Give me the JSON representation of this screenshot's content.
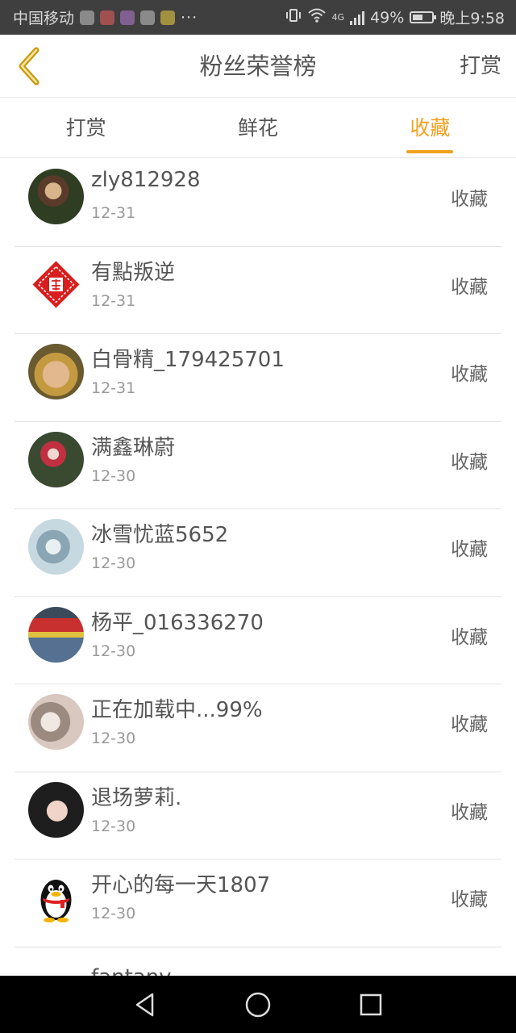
{
  "status_bar": {
    "carrier": "中国移动",
    "more": "···",
    "network_type": "4G",
    "battery": "49%",
    "time": "晚上9:58"
  },
  "header": {
    "title": "粉丝荣誉榜",
    "action": "打赏",
    "back_icon": "chevron-left-icon",
    "accent_color": "#f2a020"
  },
  "tabs": [
    {
      "label": "打赏",
      "active": false
    },
    {
      "label": "鲜花",
      "active": false
    },
    {
      "label": "收藏",
      "active": true
    }
  ],
  "fans": [
    {
      "name": "zly812928",
      "date": "12-31",
      "action": "收藏"
    },
    {
      "name": "有點叛逆",
      "date": "12-31",
      "action": "收藏"
    },
    {
      "name": "白骨精_179425701",
      "date": "12-31",
      "action": "收藏"
    },
    {
      "name": "满鑫琳蔚",
      "date": "12-30",
      "action": "收藏"
    },
    {
      "name": "冰雪忧蓝5652",
      "date": "12-30",
      "action": "收藏"
    },
    {
      "name": "杨平_016336270",
      "date": "12-30",
      "action": "收藏"
    },
    {
      "name": "正在加载中...99%",
      "date": "12-30",
      "action": "收藏"
    },
    {
      "name": "退场萝莉.",
      "date": "12-30",
      "action": "收藏"
    },
    {
      "name": "开心的每一天1807",
      "date": "12-30",
      "action": "收藏"
    },
    {
      "name": "fantany",
      "date": "",
      "action": ""
    }
  ],
  "nav": {
    "back_icon": "triangle-back-icon",
    "home_icon": "circle-home-icon",
    "recent_icon": "square-recents-icon"
  }
}
